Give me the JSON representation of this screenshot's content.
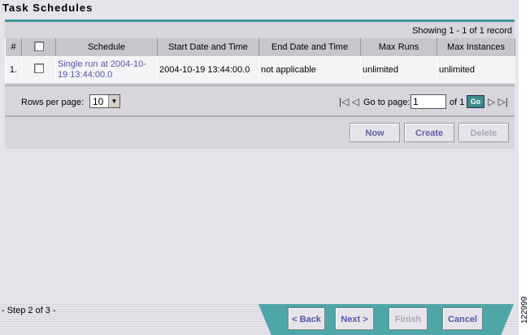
{
  "page_title": "Task Schedules",
  "showing_text": "Showing 1 - 1 of 1 record",
  "table": {
    "headers": [
      "#",
      "",
      "Schedule",
      "Start Date and Time",
      "End Date and Time",
      "Max Runs",
      "Max Instances"
    ],
    "rows": [
      {
        "index": "1.",
        "schedule": "Single run at 2004-10-19 13:44:00.0",
        "start": "2004-10-19 13:44:00.0",
        "end": "not applicable",
        "max_runs": "unlimited",
        "max_instances": "unlimited"
      }
    ]
  },
  "pager": {
    "rows_per_page_label": "Rows per page:",
    "rows_per_page_value": "10",
    "goto_label": "Go to page:",
    "page_value": "1",
    "of_label": "of 1",
    "go_label": "Go"
  },
  "actions": {
    "now": "Now",
    "create": "Create",
    "delete": "Delete"
  },
  "wizard": {
    "step_text": "- Step 2 of 3 -",
    "back": "< Back",
    "next": "Next >",
    "finish": "Finish",
    "cancel": "Cancel"
  },
  "figure_id": "122999",
  "colors": {
    "accent": "#3f9a9a",
    "link": "#5555aa",
    "wizard_bar": "#4ea6a6"
  }
}
